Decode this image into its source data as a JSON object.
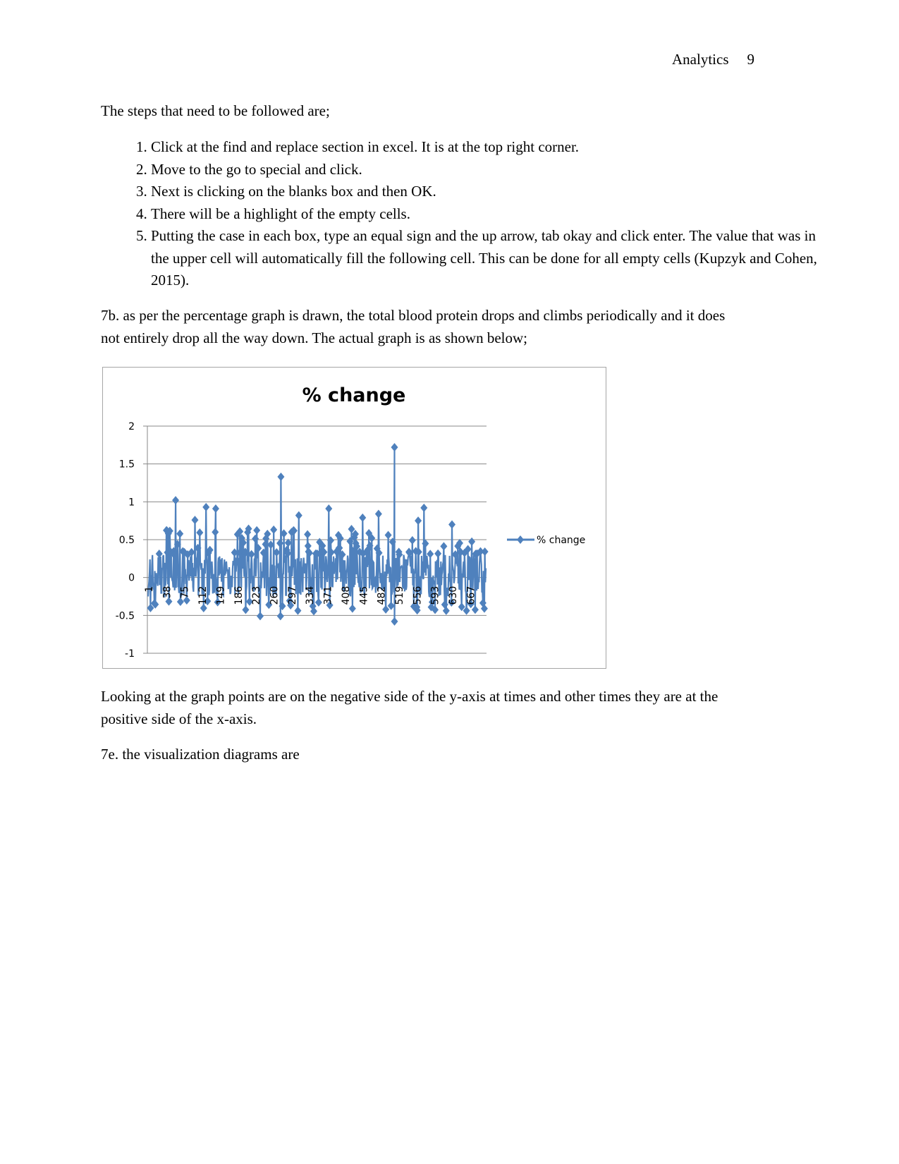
{
  "header": {
    "running_head": "Analytics",
    "page_number": "9"
  },
  "intro": "The steps that need to be followed are;",
  "steps": [
    "Click at the find and replace section in excel. It is at the top right corner.",
    "Move to the go to special and click.",
    "Next is clicking on the blanks box and then OK.",
    "There will be a highlight of the empty cells.",
    "Putting the case in each box, type an equal sign and the up arrow, tab okay and click enter. The value that was in the upper cell will automatically fill the following cell. This can be done for all empty cells (Kupzyk and Cohen, 2015)."
  ],
  "para_7b": "7b. as per the percentage graph is drawn, the total blood protein drops and climbs periodically and it does not entirely drop all the way down. The actual graph is as shown below;",
  "para_after": "Looking at the graph points are on the negative side of the y-axis at times and other times they are at the positive side of the x-axis.",
  "para_7e": "7e. the visualization diagrams are",
  "chart_data": {
    "type": "line",
    "title": "% change",
    "series": [
      {
        "name": "% change",
        "color": "#4f81bd",
        "marker": "diamond",
        "notable_points": [
          {
            "x": 58,
            "y": 1.02
          },
          {
            "x": 98,
            "y": 0.76
          },
          {
            "x": 121,
            "y": 0.93
          },
          {
            "x": 141,
            "y": 0.91
          },
          {
            "x": 276,
            "y": 1.33
          },
          {
            "x": 313,
            "y": 0.82
          },
          {
            "x": 375,
            "y": 0.91
          },
          {
            "x": 445,
            "y": 0.79
          },
          {
            "x": 478,
            "y": 0.84
          },
          {
            "x": 511,
            "y": 1.72
          },
          {
            "x": 511,
            "y": -0.58
          },
          {
            "x": 560,
            "y": 0.75
          },
          {
            "x": 572,
            "y": 0.92
          },
          {
            "x": 630,
            "y": 0.7
          },
          {
            "x": 275,
            "y": -0.51
          },
          {
            "x": 233,
            "y": -0.51
          }
        ]
      }
    ],
    "x_tick_labels": [
      "1",
      "38",
      "75",
      "112",
      "149",
      "186",
      "223",
      "260",
      "297",
      "334",
      "371",
      "408",
      "445",
      "482",
      "519",
      "556",
      "593",
      "630",
      "667"
    ],
    "y_tick_labels": [
      "2",
      "1.5",
      "1",
      "0.5",
      "0",
      "-0.5",
      "-1"
    ],
    "ylim": [
      -1,
      2
    ],
    "xlim": [
      1,
      700
    ],
    "grid": "horizontal",
    "legend": "right"
  }
}
